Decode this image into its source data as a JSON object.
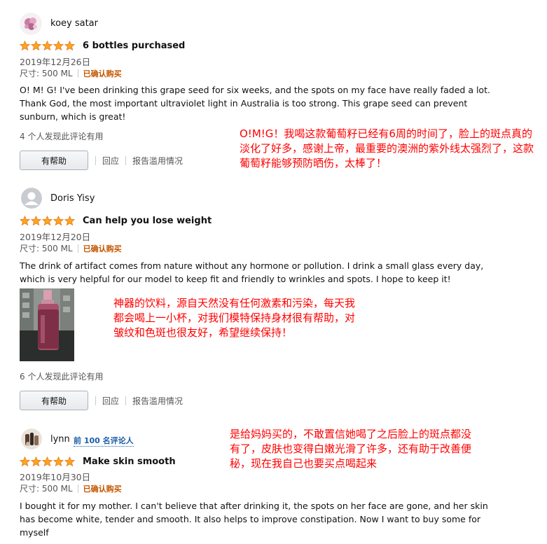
{
  "reviews": [
    {
      "reviewer": "koey satar",
      "rating": 5,
      "title": "6 bottles purchased",
      "date": "2019年12月26日",
      "size": "尺寸: 500 ML",
      "verified": "已确认购买",
      "text": "O! M! G! I've been drinking this grape seed for six weeks, and the spots on my face have really faded a lot. Thank God, the most important ultraviolet light in Australia is too strong. This grape seed can prevent sunburn, which is great!",
      "helpful_count": "4 个人发现此评论有用",
      "translation": "O!M!G！我喝这款葡萄籽已经有6周的时间了，脸上的斑点真的淡化了好多，感谢上帝，最重要的澳洲的紫外线太强烈了，这款葡萄籽能够预防晒伤，太棒了！"
    },
    {
      "reviewer": "Doris Yisy",
      "rating": 5,
      "title": "Can help you lose weight",
      "date": "2019年12月20日",
      "size": "尺寸: 500 ML",
      "verified": "已确认购买",
      "text": "The drink of artifact comes from nature without any hormone or pollution. I drink a small glass every day, which is very helpful for our model to keep fit and friendly to wrinkles and spots. I hope to keep it!",
      "helpful_count": "6 个人发现此评论有用",
      "translation": "神器的饮料，源自天然没有任何激素和污染，每天我都会喝上一小杯，对我们模特保持身材很有帮助，对皱纹和色斑也很友好，希望继续保持！"
    },
    {
      "reviewer": "lynn",
      "badge": "前 100 名评论人",
      "rating": 5,
      "title": "Make skin smooth",
      "date": "2019年10月30日",
      "size": "尺寸: 500 ML",
      "verified": "已确认购买",
      "text": "I bought it for my mother. I can't believe that after drinking it, the spots on her face are gone, and her skin has become white, tender and smooth. It also helps to improve constipation. Now I want to buy some for myself",
      "translation": "是给妈妈买的，不敢置信她喝了之后脸上的斑点都没有了，皮肤也变得白嫩光滑了许多，还有助于改善便秘，现在我自己也要买点喝起来"
    }
  ],
  "actions": {
    "helpful": "有帮助",
    "comment": "回应",
    "report": "报告滥用情况"
  },
  "colors": {
    "star": "#ffa41c",
    "verified": "#c45500",
    "translation": "#ff0000",
    "badge": "#1c5ea8"
  }
}
